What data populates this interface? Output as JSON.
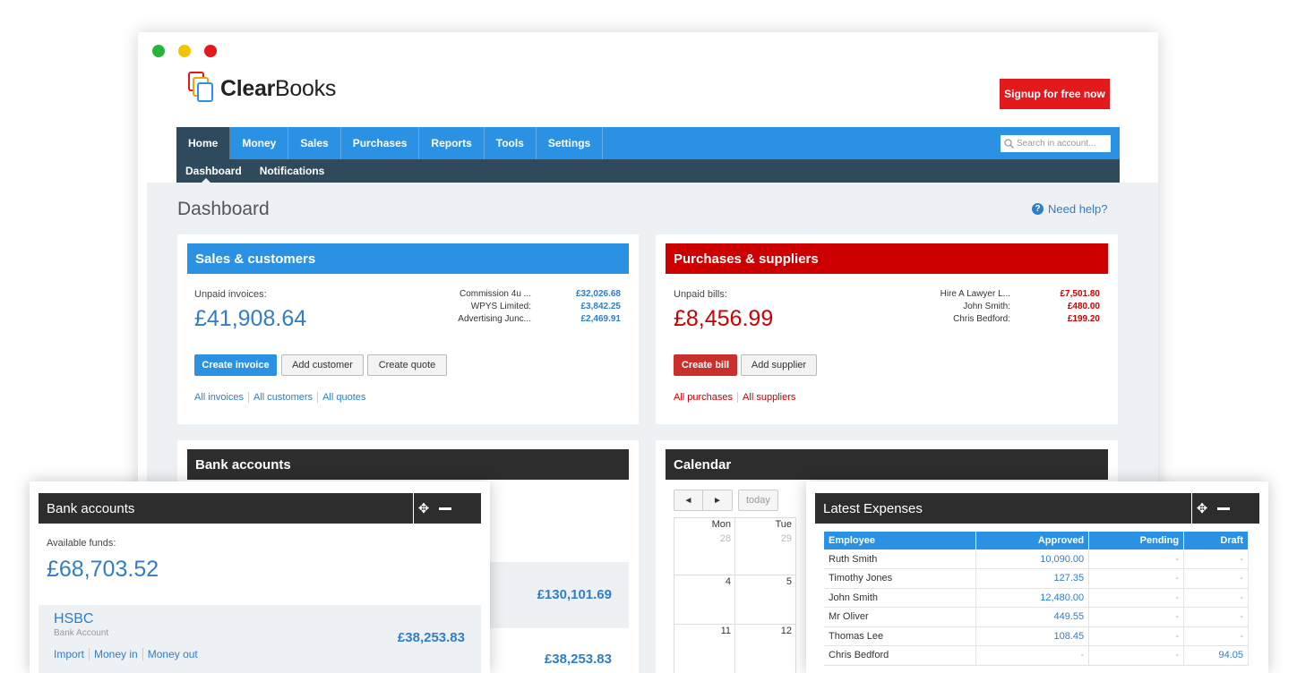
{
  "window": {
    "dot_colors": [
      "#28b33b",
      "#f5c400",
      "#e3191b"
    ]
  },
  "brand": {
    "logo_bold": "Clear",
    "logo_rest": "Books"
  },
  "signup_label": "Signup for free now",
  "nav": {
    "items": [
      "Home",
      "Money",
      "Sales",
      "Purchases",
      "Reports",
      "Tools",
      "Settings"
    ],
    "search_placeholder": "Search in account..."
  },
  "subnav": {
    "items": [
      "Dashboard",
      "Notifications"
    ]
  },
  "page": {
    "title": "Dashboard",
    "help": "Need help?"
  },
  "sales": {
    "title": "Sales & customers",
    "unpaid_label": "Unpaid invoices:",
    "unpaid_total": "£41,908.64",
    "rows": [
      {
        "name": "Commission 4u ...",
        "value": "£32,026.68"
      },
      {
        "name": "WPYS Limited:",
        "value": "£3,842.25"
      },
      {
        "name": "Advertising Junc...",
        "value": "£2,469.91"
      }
    ],
    "buttons": {
      "create": "Create invoice",
      "add": "Add customer",
      "quote": "Create quote"
    },
    "links": [
      "All invoices",
      "All customers",
      "All quotes"
    ]
  },
  "purchases": {
    "title": "Purchases & suppliers",
    "unpaid_label": "Unpaid bills:",
    "unpaid_total": "£8,456.99",
    "rows": [
      {
        "name": "Hire A Lawyer L...",
        "value": "£7,501.80"
      },
      {
        "name": "John Smith:",
        "value": "£480.00"
      },
      {
        "name": "Chris Bedford:",
        "value": "£199.20"
      }
    ],
    "buttons": {
      "create": "Create bill",
      "add": "Add supplier"
    },
    "links": [
      "All purchases",
      "All suppliers"
    ]
  },
  "bank_card": {
    "title": "Bank accounts",
    "total": "£130,101.69",
    "row2": "£38,253.83"
  },
  "calendar": {
    "title": "Calendar",
    "prev": "◄",
    "next": "►",
    "today": "today",
    "days": [
      "Mon",
      "Tue"
    ],
    "weeks": [
      [
        "28",
        "29"
      ],
      [
        "4",
        "5"
      ],
      [
        "11",
        "12"
      ]
    ]
  },
  "bank_overlay": {
    "title": "Bank accounts",
    "funds_label": "Available funds:",
    "funds": "£68,703.52",
    "account": {
      "name": "HSBC",
      "type": "Bank Account",
      "balance": "£38,253.83"
    },
    "links": [
      "Import",
      "Money in",
      "Money out"
    ]
  },
  "expenses": {
    "title": "Latest Expenses",
    "columns": [
      "Employee",
      "Approved",
      "Pending",
      "Draft"
    ],
    "rows": [
      [
        "Ruth Smith",
        "10,090.00",
        "-",
        "-"
      ],
      [
        "Timothy Jones",
        "127.35",
        "-",
        "-"
      ],
      [
        "John Smith",
        "12,480.00",
        "-",
        "-"
      ],
      [
        "Mr Oliver",
        "449.55",
        "-",
        "-"
      ],
      [
        "Thomas Lee",
        "108.45",
        "-",
        "-"
      ],
      [
        "Chris Bedford",
        "-",
        "-",
        "94.05"
      ]
    ]
  },
  "colors": {
    "blue": "#2b92e3",
    "red": "#cc0000",
    "dark": "#2d2d2d",
    "link_blue": "#2f7ec8",
    "button_red": "#c9302c"
  }
}
